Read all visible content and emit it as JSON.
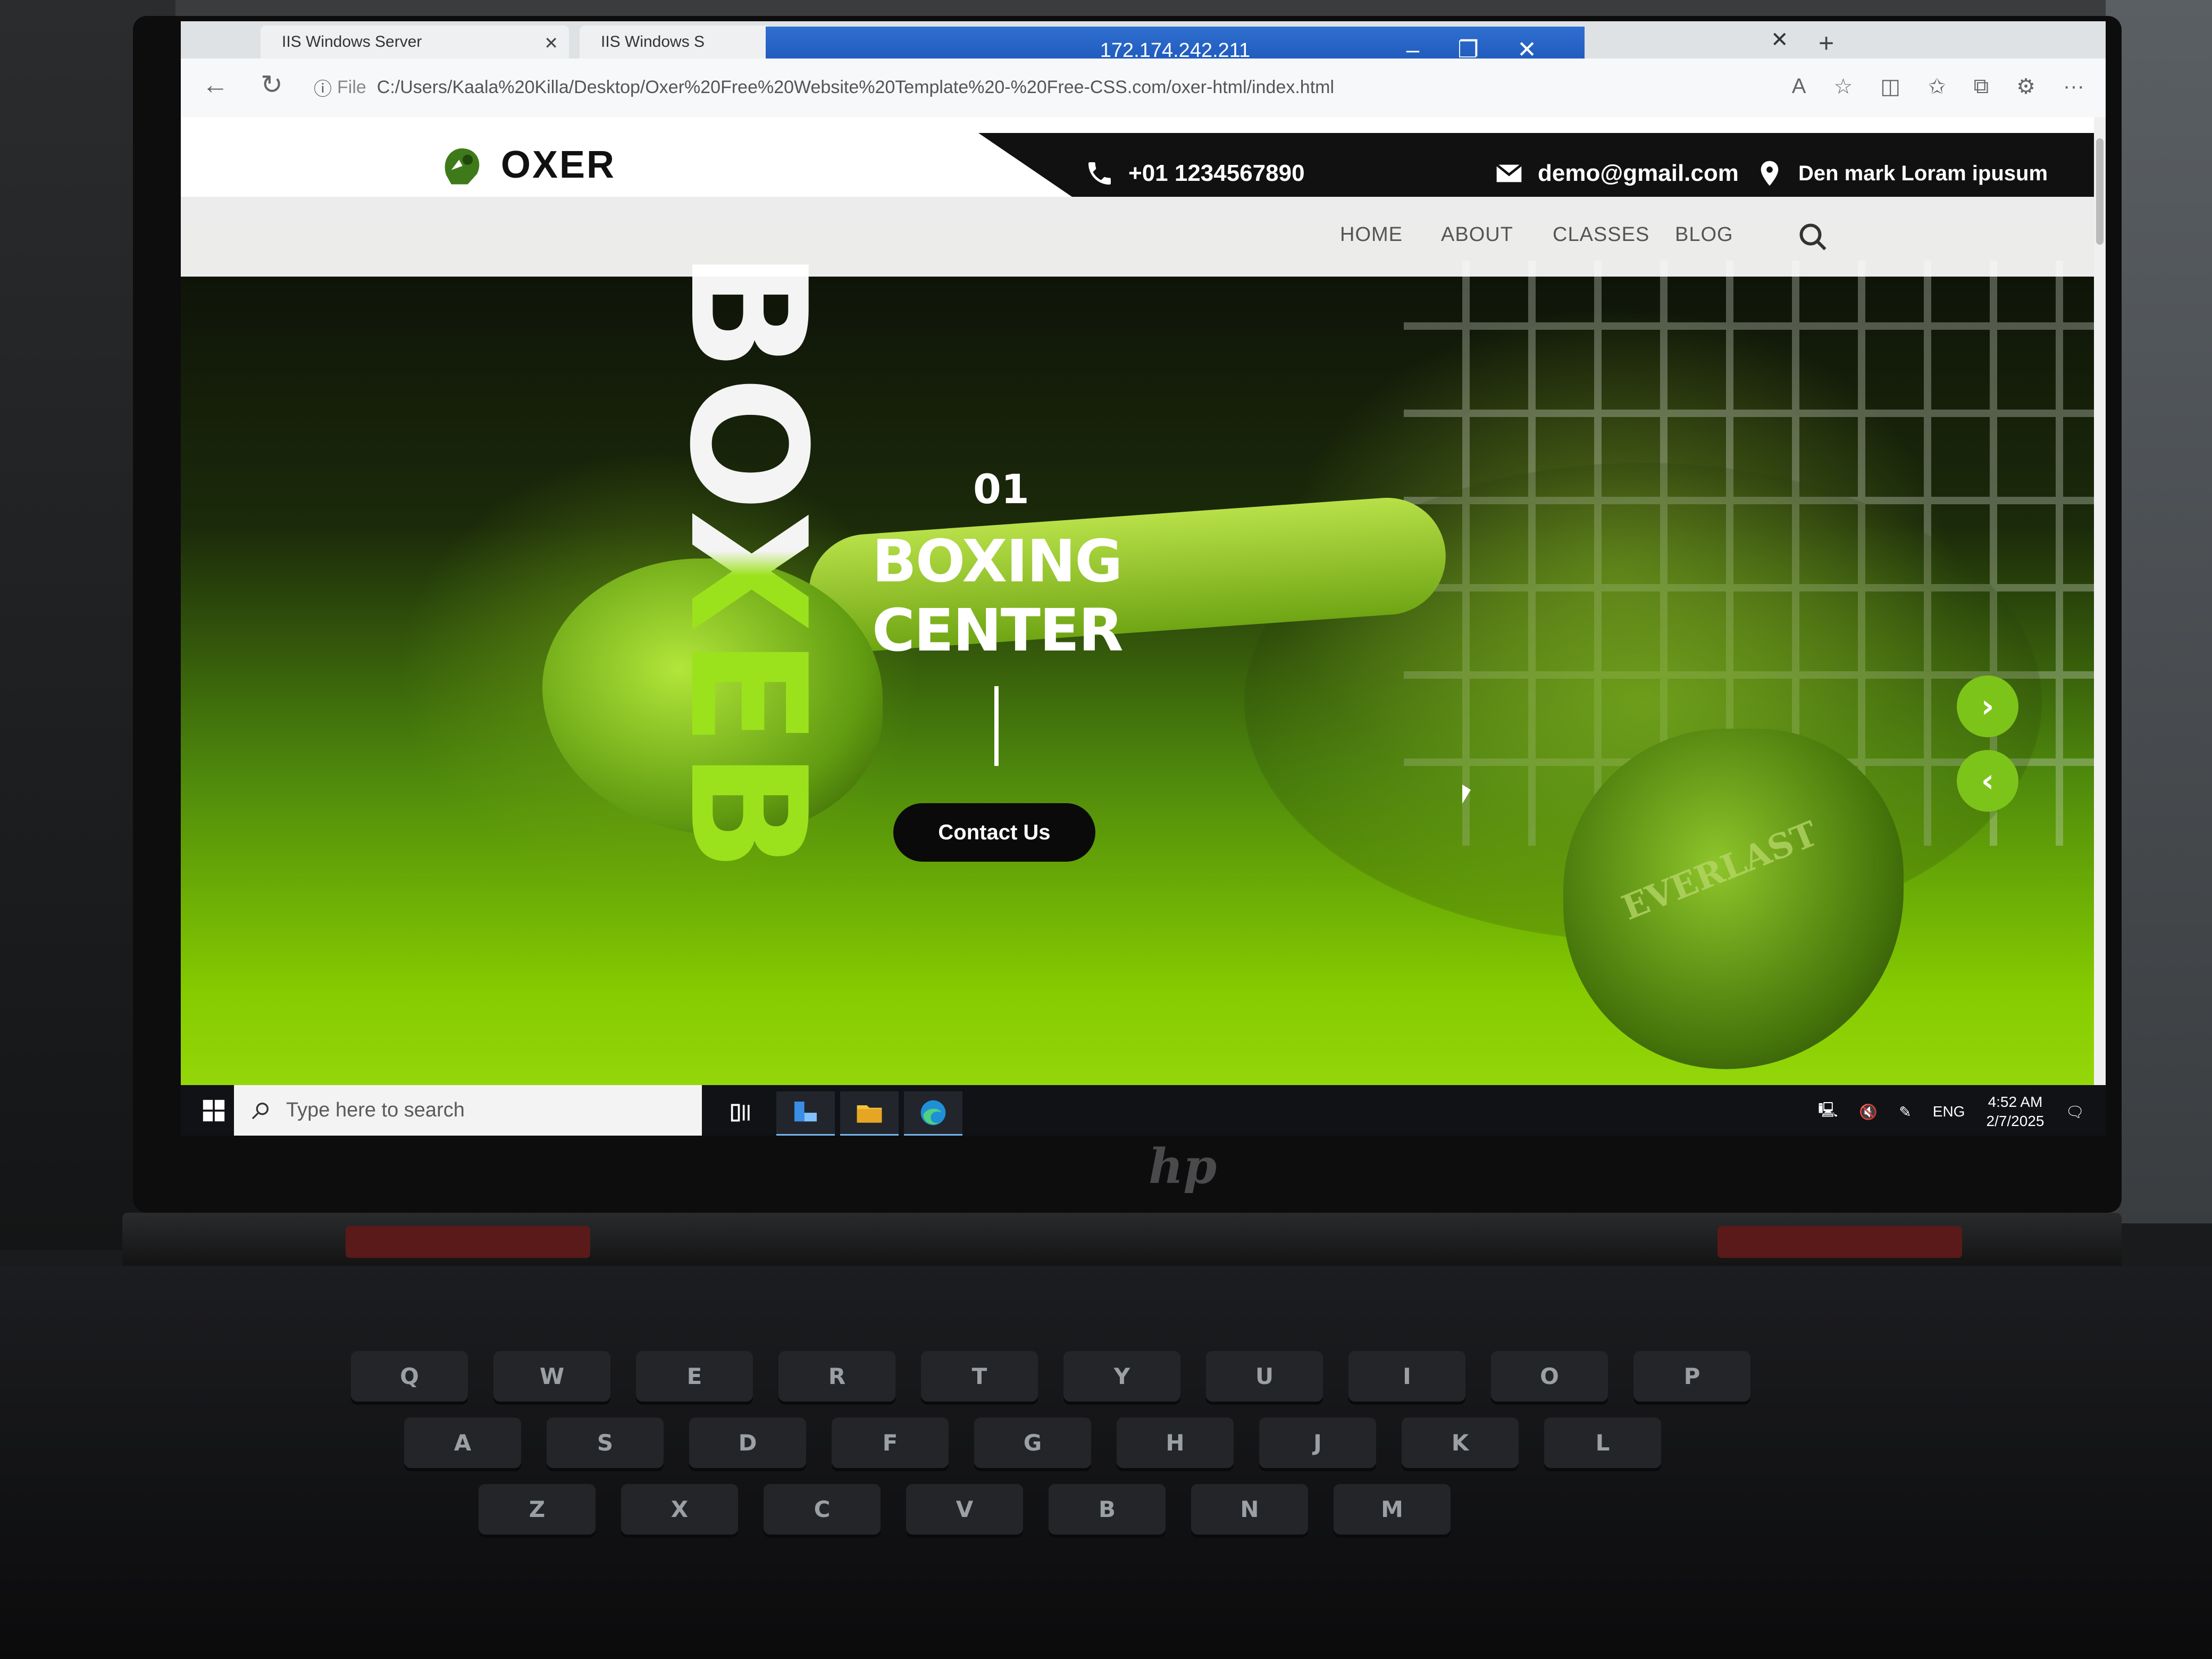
{
  "browser": {
    "tabs": [
      {
        "title": "IIS Windows Server"
      },
      {
        "title": "IIS Windows S"
      }
    ],
    "remote_session_ip": "172.174.242.211",
    "url_label": "File",
    "url": "C:/Users/Kaala%20Killa/Desktop/Oxer%20Free%20Website%20Template%20-%20Free-CSS.com/oxer-html/index.html"
  },
  "site": {
    "brand": "OXER",
    "contact": {
      "phone": "+01 1234567890",
      "email": "demo@gmail.com",
      "address": "Den mark Loram ipusum"
    },
    "nav": [
      "HOME",
      "ABOUT",
      "CLASSES",
      "BLOG"
    ],
    "hero": {
      "vertical_word": "BOXEB",
      "slide_number": "01",
      "title_line1": "BOXING",
      "title_line2": "CENTER",
      "cta_label": "Contact Us",
      "next_symbol": "›",
      "prev_symbol": "‹",
      "glove_brand": "EVERLAST"
    }
  },
  "taskbar": {
    "search_placeholder": "Type here to search",
    "language": "ENG",
    "time": "4:52 AM",
    "date": "2/7/2025"
  },
  "device": {
    "logo": "hp",
    "keys_row1": [
      "Q",
      "W",
      "E",
      "R",
      "T",
      "Y",
      "U",
      "I",
      "O",
      "P"
    ],
    "keys_row2": [
      "A",
      "S",
      "D",
      "F",
      "G",
      "H",
      "J",
      "K",
      "L"
    ],
    "keys_row3": [
      "Z",
      "X",
      "C",
      "V",
      "B",
      "N",
      "M"
    ]
  },
  "colors": {
    "accent_green": "#7cc41a",
    "hero_dark": "#0b0d08",
    "taskbar": "#101216",
    "rdp_blue": "#2f6fd0"
  }
}
